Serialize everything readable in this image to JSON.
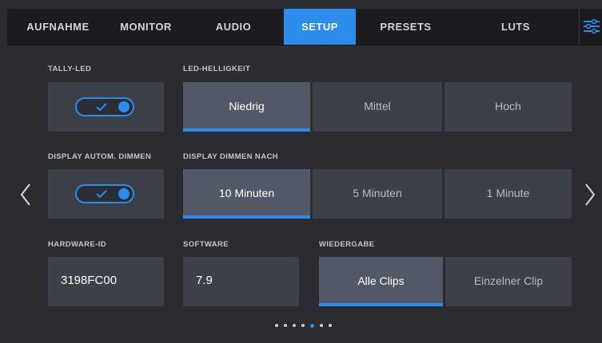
{
  "tabs": [
    {
      "label": "AUFNAHME"
    },
    {
      "label": "MONITOR"
    },
    {
      "label": "AUDIO"
    },
    {
      "label": "SETUP",
      "active": true
    },
    {
      "label": "PRESETS"
    },
    {
      "label": "LUTS"
    }
  ],
  "menu_icon": "sliders-icon",
  "row1": {
    "tally_label": "TALLY-LED",
    "tally_on": true,
    "brightness_label": "LED-HELLIGKEIT",
    "brightness_options": [
      "Niedrig",
      "Mittel",
      "Hoch"
    ],
    "brightness_selected": "Niedrig"
  },
  "row2": {
    "dimmer_label": "DISPLAY AUTOM. DIMMEN",
    "dimmer_on": true,
    "dim_after_label": "DISPLAY DIMMEN NACH",
    "dim_after_options": [
      "10 Minuten",
      "5 Minuten",
      "1 Minute"
    ],
    "dim_after_selected": "10 Minuten"
  },
  "row3": {
    "hwid_label": "HARDWARE-ID",
    "hwid_value": "3198FC00",
    "software_label": "SOFTWARE",
    "software_value": "7.9",
    "playback_label": "WIEDERGABE",
    "playback_options": [
      "Alle Clips",
      "Einzelner Clip"
    ],
    "playback_selected": "Alle Clips"
  },
  "pagination": {
    "count": 7,
    "active_index": 4
  },
  "colors": {
    "accent": "#2b8cec",
    "background": "#2a2c31",
    "tabbar": "#1b1c20"
  }
}
